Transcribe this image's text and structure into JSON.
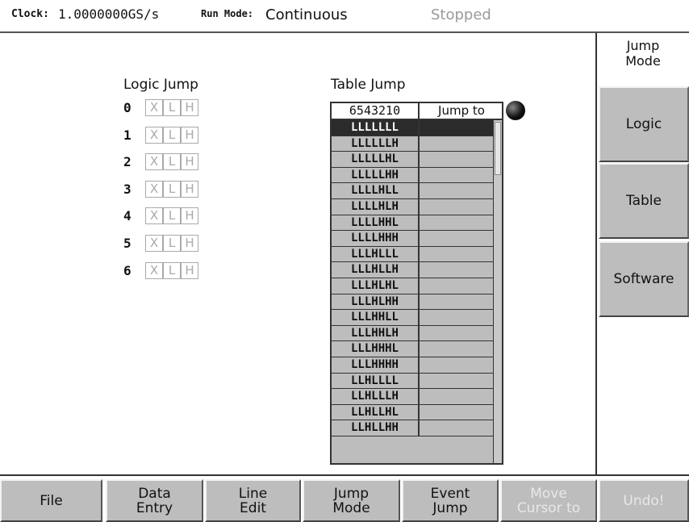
{
  "status": {
    "clock_label": "Clock:",
    "clock_value": "1.0000000GS/s",
    "run_mode_label": "Run Mode:",
    "run_mode_value": "Continuous",
    "state": "Stopped"
  },
  "logic_jump": {
    "title": "Logic Jump",
    "rows": [
      {
        "index": "0",
        "x": "X",
        "l": "L",
        "h": "H"
      },
      {
        "index": "1",
        "x": "X",
        "l": "L",
        "h": "H"
      },
      {
        "index": "2",
        "x": "X",
        "l": "L",
        "h": "H"
      },
      {
        "index": "3",
        "x": "X",
        "l": "L",
        "h": "H"
      },
      {
        "index": "4",
        "x": "X",
        "l": "L",
        "h": "H"
      },
      {
        "index": "5",
        "x": "X",
        "l": "L",
        "h": "H"
      },
      {
        "index": "6",
        "x": "X",
        "l": "L",
        "h": "H"
      }
    ]
  },
  "table_jump": {
    "title": "Table Jump",
    "col_pattern": "6543210",
    "col_jump_to": "Jump to",
    "selected_row": 0,
    "rows": [
      {
        "code": "LLLLLLL",
        "dest": ""
      },
      {
        "code": "LLLLLLH",
        "dest": ""
      },
      {
        "code": "LLLLLHL",
        "dest": ""
      },
      {
        "code": "LLLLLHH",
        "dest": ""
      },
      {
        "code": "LLLLHLL",
        "dest": ""
      },
      {
        "code": "LLLLHLH",
        "dest": ""
      },
      {
        "code": "LLLLHHL",
        "dest": ""
      },
      {
        "code": "LLLLHHH",
        "dest": ""
      },
      {
        "code": "LLLHLLL",
        "dest": ""
      },
      {
        "code": "LLLHLLH",
        "dest": ""
      },
      {
        "code": "LLLHLHL",
        "dest": ""
      },
      {
        "code": "LLLHLHH",
        "dest": ""
      },
      {
        "code": "LLLHHLL",
        "dest": ""
      },
      {
        "code": "LLLHHLH",
        "dest": ""
      },
      {
        "code": "LLLHHHL",
        "dest": ""
      },
      {
        "code": "LLLHHHH",
        "dest": ""
      },
      {
        "code": "LLHLLLL",
        "dest": ""
      },
      {
        "code": "LLHLLLH",
        "dest": ""
      },
      {
        "code": "LLHLLHL",
        "dest": ""
      },
      {
        "code": "LLHLLHH",
        "dest": ""
      }
    ]
  },
  "side_menu": {
    "title": "Jump\nMode",
    "buttons": [
      "Logic",
      "Table",
      "Software"
    ]
  },
  "bottom_menu": {
    "buttons": [
      {
        "label": "File",
        "enabled": true
      },
      {
        "label": "Data\nEntry",
        "enabled": true
      },
      {
        "label": "Line\nEdit",
        "enabled": true
      },
      {
        "label": "Jump\nMode",
        "enabled": true
      },
      {
        "label": "Event\nJump",
        "enabled": true
      },
      {
        "label": "Move\nCursor to",
        "enabled": false
      },
      {
        "label": "Undo!",
        "enabled": false
      }
    ]
  },
  "colors": {
    "button_face": "#bdbdbd",
    "selected_row": "#2b2b2b",
    "disabled_text": "#e8e8e8",
    "inactive_status": "#9a9a9a"
  },
  "icons": {
    "jump_knob": "knob-icon"
  }
}
